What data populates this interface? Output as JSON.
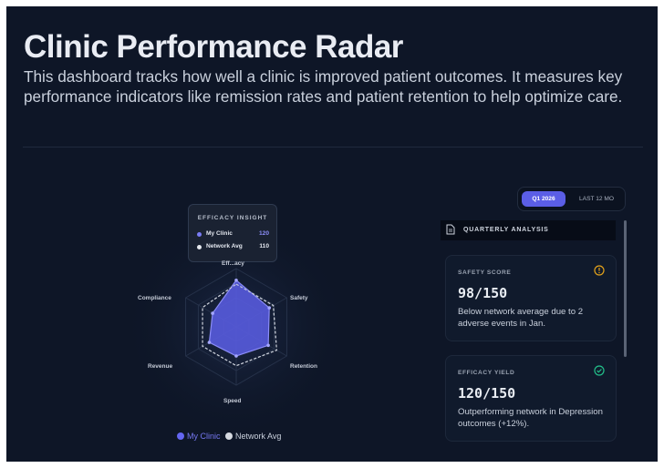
{
  "header": {
    "title": "Clinic Performance Radar",
    "description": "This dashboard tracks how well a clinic is improved patient outcomes. It measures key performance indicators like remission rates and patient retention to help optimize care."
  },
  "radar": {
    "axes": [
      "Efficacy",
      "Safety",
      "Retention",
      "Speed",
      "Revenue",
      "Compliance"
    ],
    "axis_label_top_visible": "Eff...acy",
    "my_clinic_color": "#6466f1",
    "network_color": "#d5d9e0"
  },
  "tooltip": {
    "title": "EFFICACY INSIGHT",
    "rows": [
      {
        "label": "My Clinic",
        "value": "120",
        "color": "#7a7cf5"
      },
      {
        "label": "Network Avg",
        "value": "110",
        "color": "#e6e9ef"
      }
    ]
  },
  "legend": [
    {
      "label": "My Clinic",
      "color": "#6466f1"
    },
    {
      "label": "Network Avg",
      "color": "#d5d9e0"
    }
  ],
  "period_toggle": {
    "active": "Q1 2026",
    "inactive": "LAST 12 MO"
  },
  "analysis": {
    "header": "QUARTERLY ANALYSIS",
    "cards": [
      {
        "label": "SAFETY SCORE",
        "icon": "warning-circle-icon",
        "value": "98/150",
        "description": "Below network average due to 2 adverse events in Jan.",
        "icon_color": "#e3a21a"
      },
      {
        "label": "EFFICACY YIELD",
        "icon": "check-circle-icon",
        "value": "120/150",
        "description": "Outperforming network in Depression outcomes (+12%).",
        "icon_color": "#22c08a"
      }
    ]
  },
  "chart_data": {
    "type": "radar",
    "categories": [
      "Efficacy",
      "Safety",
      "Retention",
      "Speed",
      "Revenue",
      "Compliance"
    ],
    "series": [
      {
        "name": "My Clinic",
        "values": [
          120,
          98,
          95,
          75,
          80,
          70
        ]
      },
      {
        "name": "Network Avg",
        "values": [
          110,
          110,
          120,
          100,
          100,
          100
        ]
      }
    ],
    "max": 150
  }
}
